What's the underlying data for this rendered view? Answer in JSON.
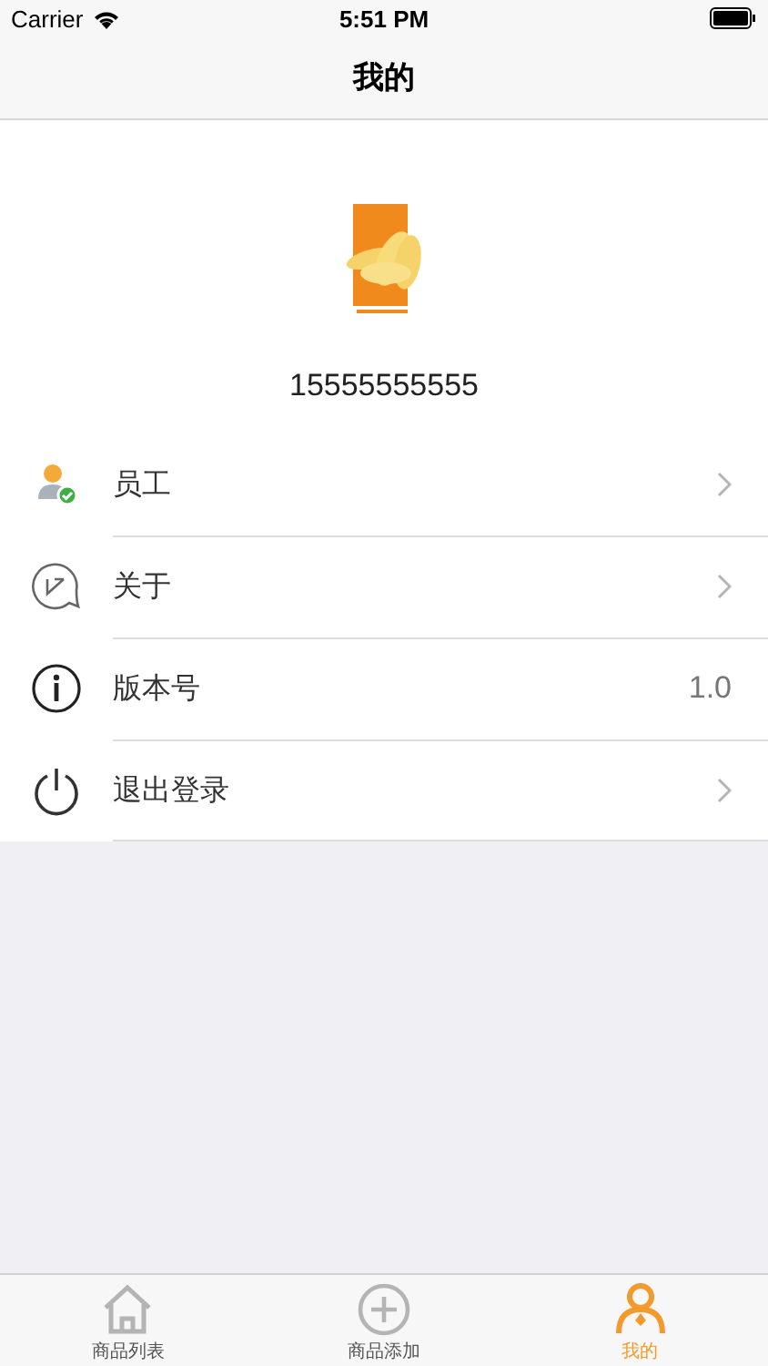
{
  "status_bar": {
    "carrier": "Carrier",
    "time": "5:51 PM"
  },
  "nav": {
    "title": "我的"
  },
  "profile": {
    "phone": "15555555555"
  },
  "menu": [
    {
      "label": "员工",
      "kind": "link"
    },
    {
      "label": "关于",
      "kind": "link"
    },
    {
      "label": "版本号",
      "kind": "value",
      "value": "1.0"
    },
    {
      "label": "退出登录",
      "kind": "link"
    }
  ],
  "tabs": [
    {
      "label": "商品列表",
      "selected": false
    },
    {
      "label": "商品添加",
      "selected": false
    },
    {
      "label": "我的",
      "selected": true
    }
  ]
}
